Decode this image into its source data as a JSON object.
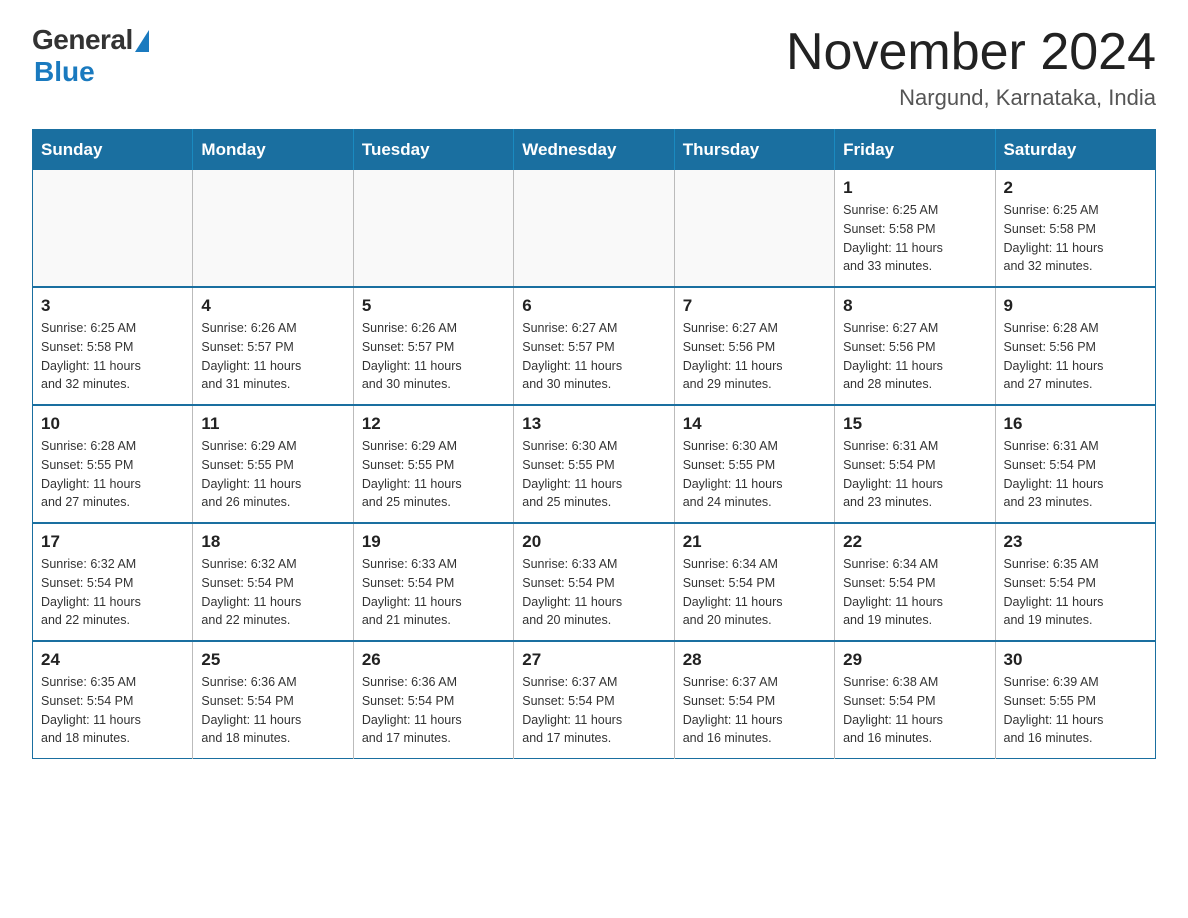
{
  "logo": {
    "text_general": "General",
    "text_blue": "Blue"
  },
  "title": "November 2024",
  "subtitle": "Nargund, Karnataka, India",
  "days_of_week": [
    "Sunday",
    "Monday",
    "Tuesday",
    "Wednesday",
    "Thursday",
    "Friday",
    "Saturday"
  ],
  "weeks": [
    [
      {
        "day": "",
        "info": ""
      },
      {
        "day": "",
        "info": ""
      },
      {
        "day": "",
        "info": ""
      },
      {
        "day": "",
        "info": ""
      },
      {
        "day": "",
        "info": ""
      },
      {
        "day": "1",
        "info": "Sunrise: 6:25 AM\nSunset: 5:58 PM\nDaylight: 11 hours\nand 33 minutes."
      },
      {
        "day": "2",
        "info": "Sunrise: 6:25 AM\nSunset: 5:58 PM\nDaylight: 11 hours\nand 32 minutes."
      }
    ],
    [
      {
        "day": "3",
        "info": "Sunrise: 6:25 AM\nSunset: 5:58 PM\nDaylight: 11 hours\nand 32 minutes."
      },
      {
        "day": "4",
        "info": "Sunrise: 6:26 AM\nSunset: 5:57 PM\nDaylight: 11 hours\nand 31 minutes."
      },
      {
        "day": "5",
        "info": "Sunrise: 6:26 AM\nSunset: 5:57 PM\nDaylight: 11 hours\nand 30 minutes."
      },
      {
        "day": "6",
        "info": "Sunrise: 6:27 AM\nSunset: 5:57 PM\nDaylight: 11 hours\nand 30 minutes."
      },
      {
        "day": "7",
        "info": "Sunrise: 6:27 AM\nSunset: 5:56 PM\nDaylight: 11 hours\nand 29 minutes."
      },
      {
        "day": "8",
        "info": "Sunrise: 6:27 AM\nSunset: 5:56 PM\nDaylight: 11 hours\nand 28 minutes."
      },
      {
        "day": "9",
        "info": "Sunrise: 6:28 AM\nSunset: 5:56 PM\nDaylight: 11 hours\nand 27 minutes."
      }
    ],
    [
      {
        "day": "10",
        "info": "Sunrise: 6:28 AM\nSunset: 5:55 PM\nDaylight: 11 hours\nand 27 minutes."
      },
      {
        "day": "11",
        "info": "Sunrise: 6:29 AM\nSunset: 5:55 PM\nDaylight: 11 hours\nand 26 minutes."
      },
      {
        "day": "12",
        "info": "Sunrise: 6:29 AM\nSunset: 5:55 PM\nDaylight: 11 hours\nand 25 minutes."
      },
      {
        "day": "13",
        "info": "Sunrise: 6:30 AM\nSunset: 5:55 PM\nDaylight: 11 hours\nand 25 minutes."
      },
      {
        "day": "14",
        "info": "Sunrise: 6:30 AM\nSunset: 5:55 PM\nDaylight: 11 hours\nand 24 minutes."
      },
      {
        "day": "15",
        "info": "Sunrise: 6:31 AM\nSunset: 5:54 PM\nDaylight: 11 hours\nand 23 minutes."
      },
      {
        "day": "16",
        "info": "Sunrise: 6:31 AM\nSunset: 5:54 PM\nDaylight: 11 hours\nand 23 minutes."
      }
    ],
    [
      {
        "day": "17",
        "info": "Sunrise: 6:32 AM\nSunset: 5:54 PM\nDaylight: 11 hours\nand 22 minutes."
      },
      {
        "day": "18",
        "info": "Sunrise: 6:32 AM\nSunset: 5:54 PM\nDaylight: 11 hours\nand 22 minutes."
      },
      {
        "day": "19",
        "info": "Sunrise: 6:33 AM\nSunset: 5:54 PM\nDaylight: 11 hours\nand 21 minutes."
      },
      {
        "day": "20",
        "info": "Sunrise: 6:33 AM\nSunset: 5:54 PM\nDaylight: 11 hours\nand 20 minutes."
      },
      {
        "day": "21",
        "info": "Sunrise: 6:34 AM\nSunset: 5:54 PM\nDaylight: 11 hours\nand 20 minutes."
      },
      {
        "day": "22",
        "info": "Sunrise: 6:34 AM\nSunset: 5:54 PM\nDaylight: 11 hours\nand 19 minutes."
      },
      {
        "day": "23",
        "info": "Sunrise: 6:35 AM\nSunset: 5:54 PM\nDaylight: 11 hours\nand 19 minutes."
      }
    ],
    [
      {
        "day": "24",
        "info": "Sunrise: 6:35 AM\nSunset: 5:54 PM\nDaylight: 11 hours\nand 18 minutes."
      },
      {
        "day": "25",
        "info": "Sunrise: 6:36 AM\nSunset: 5:54 PM\nDaylight: 11 hours\nand 18 minutes."
      },
      {
        "day": "26",
        "info": "Sunrise: 6:36 AM\nSunset: 5:54 PM\nDaylight: 11 hours\nand 17 minutes."
      },
      {
        "day": "27",
        "info": "Sunrise: 6:37 AM\nSunset: 5:54 PM\nDaylight: 11 hours\nand 17 minutes."
      },
      {
        "day": "28",
        "info": "Sunrise: 6:37 AM\nSunset: 5:54 PM\nDaylight: 11 hours\nand 16 minutes."
      },
      {
        "day": "29",
        "info": "Sunrise: 6:38 AM\nSunset: 5:54 PM\nDaylight: 11 hours\nand 16 minutes."
      },
      {
        "day": "30",
        "info": "Sunrise: 6:39 AM\nSunset: 5:55 PM\nDaylight: 11 hours\nand 16 minutes."
      }
    ]
  ]
}
